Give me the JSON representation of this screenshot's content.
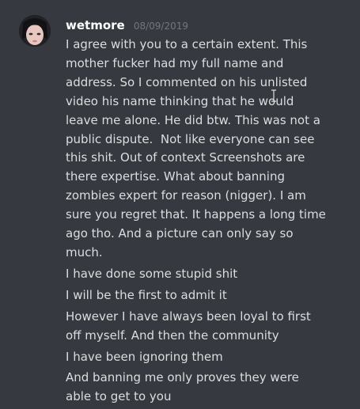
{
  "message": {
    "author": "wetmore",
    "timestamp": "08/09/2019",
    "lines": [
      "I agree with you to a certain extent. This mother fucker had my full name and address. So I commented on his unlisted video his name thinking that he would leave me alone. He did btw. This was not a public dispute.  Not like everyone can see this shit. Out of context Screenshots are there expertise. What about banning zombies expert for reason (nigger). I am sure you regret that. It happens a long time ago tho. And a picture can only say so much.",
      "I have done some stupid shit",
      "I will be the first to admit it",
      "However I have always been loyal to first off myself. And then the community",
      "I have been ignoring them",
      "And banning me only proves they were able to get to you"
    ]
  },
  "colors": {
    "background": "#36393f",
    "username": "#ffffff",
    "timestamp": "#72767d",
    "text": "#dcddde"
  },
  "icons": {
    "avatar": "user-avatar",
    "cursor": "text-cursor-icon"
  }
}
